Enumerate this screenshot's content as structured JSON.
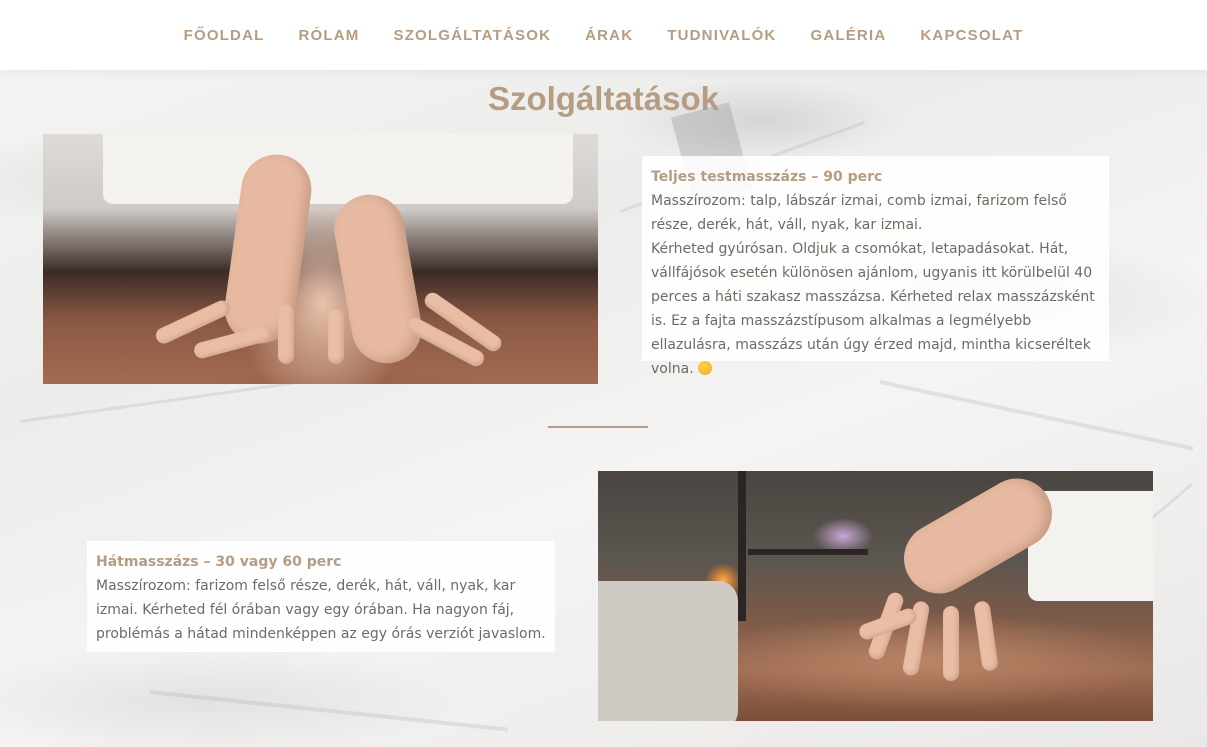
{
  "nav": {
    "items": [
      {
        "label": "FŐOLDAL"
      },
      {
        "label": "RÓLAM"
      },
      {
        "label": "SZOLGÁLTATÁSOK"
      },
      {
        "label": "ÁRAK"
      },
      {
        "label": "TUDNIVALÓK"
      },
      {
        "label": "GALÉRIA"
      },
      {
        "label": "KAPCSOLAT"
      }
    ]
  },
  "page": {
    "title": "Szolgáltatások"
  },
  "services": [
    {
      "title": "Teljes testmasszázs – 90 perc",
      "line1": "Masszírozom: talp, lábszár izmai, comb izmai, farizom felső része, derék, hát, váll, nyak, kar izmai.",
      "line2": "Kérheted gyúrósan. Oldjuk a csomókat, letapadásokat. Hát, vállfájósok esetén különösen ajánlom, ugyanis itt körülbelül 40 perces a háti szakasz masszázsa. Kérheted relax masszázsként is. Ez a fajta masszázstípusom alkalmas a legmélyebb ellazulásra, masszázs után úgy érzed majd, mintha kicseréltek volna.",
      "emoji_icon": "smiling-face-emoji"
    },
    {
      "title": "Hátmasszázs – 30 vagy 60 perc",
      "line1": "Masszírozom: farizom felső része, derék, hát, váll, nyak, kar izmai.",
      "line2": "Kérheted fél órában vagy egy órában. Ha nagyon fáj, problémás a hátad mindenképpen az egy órás verziót javaslom."
    }
  ],
  "colors": {
    "accent": "#b59c82",
    "text": "#6f6a66"
  }
}
